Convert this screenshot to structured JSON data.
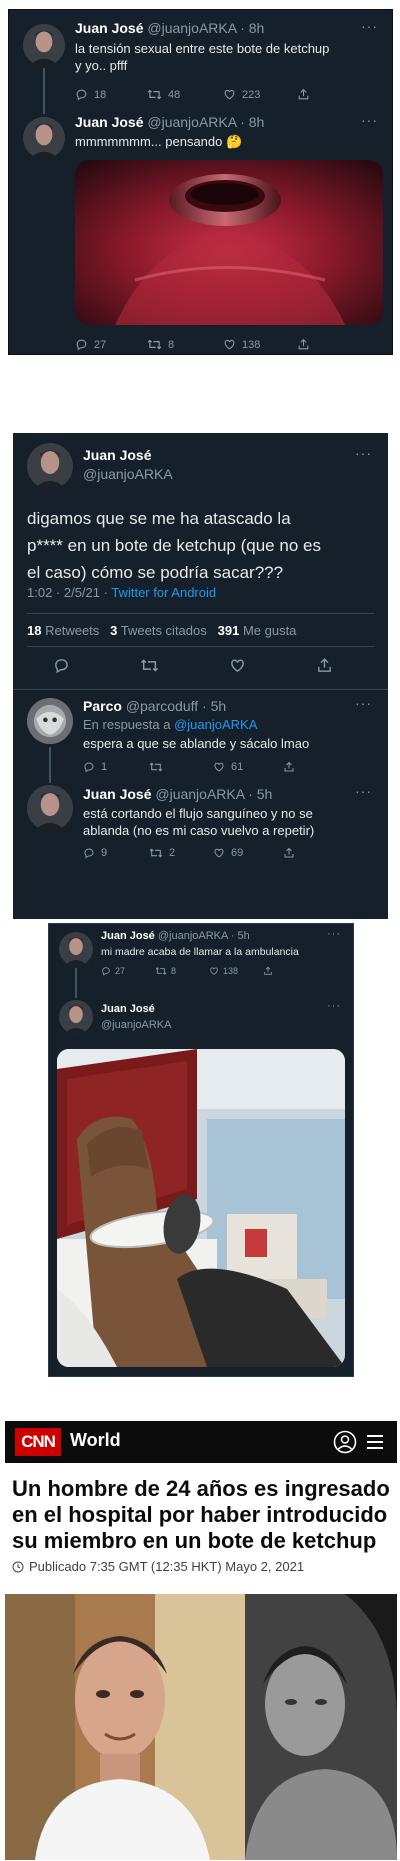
{
  "panel1": {
    "tweet1": {
      "name": "Juan José",
      "handle": "@juanjoARKA",
      "time": "· 8h",
      "text_line1": "la tensión sexual entre este bote de ketchup",
      "text_line2": "y yo.. pfff",
      "replies": "18",
      "retweets": "48",
      "likes": "223"
    },
    "tweet2": {
      "name": "Juan José",
      "handle": "@juanjoARKA",
      "time": "· 8h",
      "text": "mmmmmmm... pensando 🤔",
      "replies": "27",
      "retweets": "8",
      "likes": "138"
    }
  },
  "panel2": {
    "name": "Juan José",
    "handle": "@juanjoARKA",
    "text_line1": "digamos que se me ha atascado la",
    "text_line2": "p**** en un bote de ketchup (que no es",
    "text_line3": "el caso) cómo se podría sacar???",
    "timestamp": "1:02 · 2/5/21 ·",
    "client": "Twitter for Android",
    "retweets_count": "18",
    "retweets_label": "Retweets",
    "quotes_count": "3",
    "quotes_label": "Tweets citados",
    "likes_count": "391",
    "likes_label": "Me gusta",
    "reply1": {
      "name": "Parco",
      "handle": "@parcoduff",
      "time": "· 5h",
      "replying_prefix": "En respuesta a",
      "replying_to": "@juanjoARKA",
      "text": "espera a que se ablande y sácalo lmao",
      "replies": "1",
      "retweets": "",
      "likes": "61"
    },
    "reply2": {
      "name": "Juan José",
      "handle": "@juanjoARKA",
      "time": "· 5h",
      "text_line1": "está cortando el flujo sanguíneo y no se",
      "text_line2": "ablanda (no es mi caso vuelvo a repetir)",
      "replies": "9",
      "retweets": "2",
      "likes": "69"
    }
  },
  "panel3": {
    "tweet1": {
      "name": "Juan José",
      "handle": "@juanjoARKA",
      "time": "· 5h",
      "text": "mi madre acaba de llamar a la ambulancia",
      "replies": "27",
      "retweets": "8",
      "likes": "138"
    },
    "tweet2": {
      "name": "Juan José",
      "handle": "@juanjoARKA"
    }
  },
  "cnn": {
    "logo": "CNN",
    "section": "World",
    "headline_line1": "Un hombre de 24 años es ingresado",
    "headline_line2": "en el hospital por haber introducido",
    "headline_line3": "su miembro en un bote de ketchup",
    "published": "Publicado 7:35 GMT (12:35 HKT) Mayo 2, 2021"
  },
  "icons": [
    "reply-icon",
    "retweet-icon",
    "like-icon",
    "share-icon",
    "more-icon",
    "user-account-icon",
    "menu-icon",
    "clock-icon"
  ],
  "colors": {
    "tweet_bg": "#15202b",
    "link": "#1d9bf0",
    "muted": "#8b98a5",
    "cnn_red": "#cc0000"
  }
}
